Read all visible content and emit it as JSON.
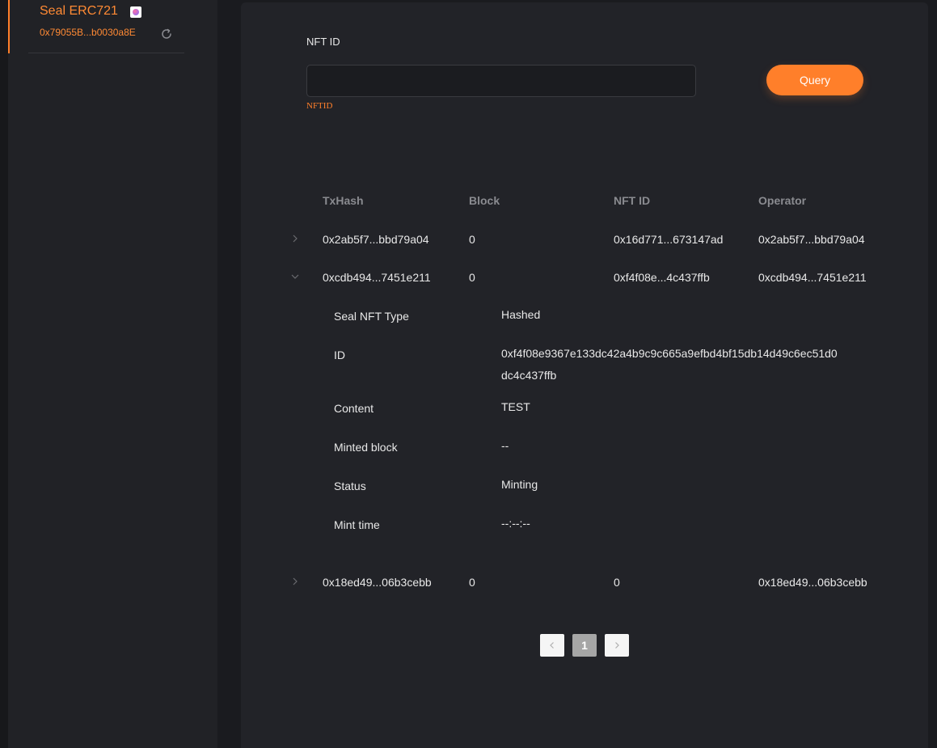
{
  "sidebar": {
    "item": {
      "title": "Seal ERC721",
      "address": "0x79055B...b0030a8E",
      "badge_icon": "nft-badge-icon",
      "refresh_icon": "refresh-icon"
    }
  },
  "form": {
    "label": "NFT ID",
    "input_value": "",
    "input_placeholder": "",
    "error": "NFTID",
    "query_label": "Query"
  },
  "table": {
    "headers": [
      "TxHash",
      "Block",
      "NFT ID",
      "Operator"
    ],
    "rows": [
      {
        "txhash": "0x2ab5f7...bbd79a04",
        "block": "0",
        "nft_id": "0x16d771...673147ad",
        "operator": "0x2ab5f7...bbd79a04",
        "expanded": false
      },
      {
        "txhash": "0xcdb494...7451e211",
        "block": "0",
        "nft_id": "0xf4f08e...4c437ffb",
        "operator": "0xcdb494...7451e211",
        "expanded": true
      },
      {
        "txhash": "0x18ed49...06b3cebb",
        "block": "0",
        "nft_id": "0",
        "operator": "0x18ed49...06b3cebb",
        "expanded": false
      }
    ],
    "details": [
      {
        "label": "Seal NFT Type",
        "value": "Hashed"
      },
      {
        "label": "ID",
        "value": "0xf4f08e9367e133dc42a4b9c9c665a9efbd4bf15db14d49c6ec51d0dc4c437ffb"
      },
      {
        "label": "Content",
        "value": "TEST"
      },
      {
        "label": "Minted block",
        "value": "--"
      },
      {
        "label": "Status",
        "value": "Minting"
      },
      {
        "label": "Mint time",
        "value": "--:--:--"
      }
    ]
  },
  "pagination": {
    "prev_icon": "chevron-left-icon",
    "current_page": "1",
    "next_icon": "chevron-right-icon"
  },
  "colors": {
    "accent": "#ff7f2a",
    "panel": "#222328",
    "sidebar": "#212226",
    "background": "#1a1b1f"
  }
}
